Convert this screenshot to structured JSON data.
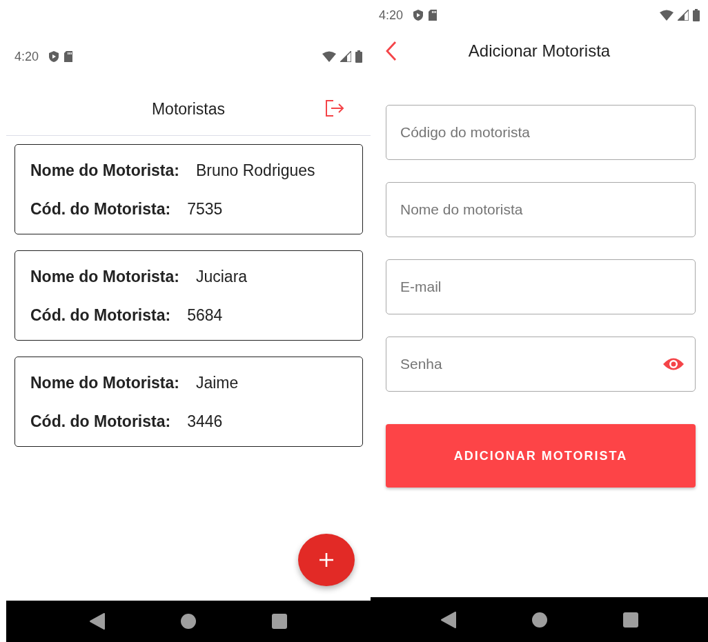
{
  "drivers_screen": {
    "status_bar": {
      "time": "4:20"
    },
    "title": "Motoristas",
    "drivers": [
      {
        "name_label": "Nome do Motorista:",
        "name": "Bruno Rodrigues",
        "code_label": "Cód. do Motorista:",
        "code": "7535"
      },
      {
        "name_label": "Nome do Motorista:",
        "name": "Juciara",
        "code_label": "Cód. do Motorista:",
        "code": "5684"
      },
      {
        "name_label": "Nome do Motorista:",
        "name": "Jaime",
        "code_label": "Cód. do Motorista:",
        "code": "3446"
      }
    ]
  },
  "add_driver_screen": {
    "status_bar": {
      "time": "4:20"
    },
    "title": "Adicionar Motorista",
    "fields": [
      {
        "kind": "text",
        "placeholder": "Código do motorista"
      },
      {
        "kind": "text",
        "placeholder": "Nome do motorista"
      },
      {
        "kind": "text",
        "placeholder": "E-mail"
      },
      {
        "kind": "password",
        "placeholder": "Senha"
      }
    ],
    "submit_button": "ADICIONAR MOTORISTA"
  }
}
